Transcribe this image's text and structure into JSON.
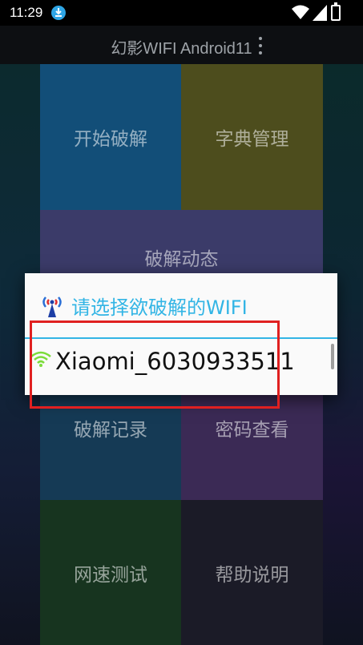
{
  "status_bar": {
    "time": "11:29",
    "icons": [
      "download-icon",
      "wifi-icon",
      "signal-icon",
      "battery-icon"
    ]
  },
  "app_bar": {
    "title": "幻影WIFI Android11",
    "menu_icon": "overflow-menu-icon"
  },
  "tiles": {
    "start_crack": "开始破解",
    "dictionary": "字典管理",
    "crack_status": "破解动态",
    "crack_records": "破解记录",
    "password_view": "密码查看",
    "speed_test": "网速测试",
    "help": "帮助说明"
  },
  "dialog": {
    "title": "请选择欲破解的WIFI",
    "title_color": "#33b5e5",
    "items": [
      {
        "ssid": "Xiaomi_6030933511",
        "icon": "wifi-signal-icon"
      }
    ]
  },
  "highlight_color": "#e02020"
}
